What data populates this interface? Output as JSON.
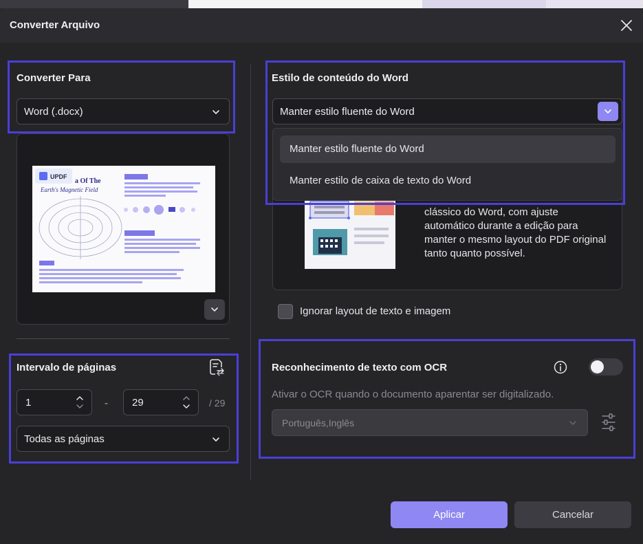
{
  "window": {
    "title": "Converter Arquivo"
  },
  "left": {
    "convert_to_heading": "Converter Para",
    "format_value": "Word (.docx)",
    "preview": {
      "logo_text": "UPDF",
      "doc_title_line1": "a Of The",
      "doc_title_line2": "Earth's Magnetic Field"
    },
    "page_range_heading": "Intervalo de páginas",
    "from_page": "1",
    "to_page": "29",
    "dash": "-",
    "total_pages": "/ 29",
    "pages_select_value": "Todas as páginas"
  },
  "right": {
    "word_style_heading": "Estilo de conteúdo do Word",
    "style_select_value": "Manter estilo fluente do Word",
    "dropdown_options": [
      "Manter estilo fluente do Word",
      "Manter estilo de caixa de texto do Word"
    ],
    "description": "clássico do Word, com ajuste automático durante a edição para manter o mesmo layout do PDF original tanto quanto possível.",
    "ignore_layout_label": "Ignorar layout de texto e imagem",
    "ocr_heading": "Reconhecimento de texto com OCR",
    "ocr_subtext": "Ativar o OCR quando o documento aparentar ser digitalizado.",
    "ocr_languages": "Português,Inglês"
  },
  "buttons": {
    "apply": "Aplicar",
    "cancel": "Cancelar"
  },
  "colors": {
    "accent": "#8f87f2",
    "highlight": "#4a3fd6",
    "dialog_bg": "#252528"
  }
}
